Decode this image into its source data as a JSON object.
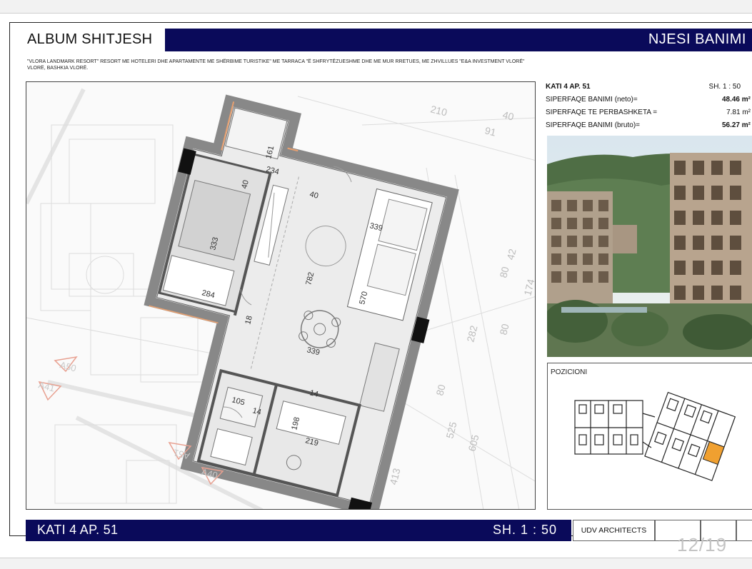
{
  "header": {
    "album_title": "ALBUM SHITJESH",
    "section_title": "NJESI BANIMI",
    "description": "\"VLORA LANDMARK RESORT\" RESORT ME HOTELERI DHE APARTAMENTE ME SHËRBIME TURISTIKE\" ME TARRACA \"Ë SHFRYTËZUESHME DHE ME MUR RRETUES, ME ZHVILLUES \"E&A INVESTMENT VLORË\" VLORË, BASHKIA VLORË."
  },
  "info": {
    "unit_label": "KATI 4 AP. 51",
    "scale_label": "SH.  1 : 50",
    "rows": [
      {
        "label": "SIPERFAQE BANIMI (neto)=",
        "value": "48.46 m²"
      },
      {
        "label": "SIPERFAQE TE PERBASHKETA =",
        "value": "7.81 m²"
      },
      {
        "label": "SIPERFAQE BANIMI (bruto)=",
        "value": "56.27 m²"
      }
    ]
  },
  "plan": {
    "dimensions": [
      "161",
      "234",
      "40",
      "40",
      "333",
      "339",
      "782",
      "284",
      "570",
      "339",
      "105",
      "14",
      "198",
      "219",
      "14",
      "18"
    ],
    "surrounding_dims": [
      "210",
      "40",
      "91",
      "80",
      "42",
      "174",
      "80",
      "282",
      "80",
      "525",
      "605",
      "413"
    ],
    "neighbor_labels": [
      "A50",
      "A41",
      "A51",
      "A40"
    ]
  },
  "position": {
    "label": "POZICIONI"
  },
  "footer": {
    "unit": "KATI 4 AP. 51",
    "scale": "SH.  1 : 50",
    "architects": "UDV ARCHITECTS",
    "page": "12/19"
  },
  "colors": {
    "navy": "#0a0a5a",
    "highlight": "#f0a030"
  }
}
